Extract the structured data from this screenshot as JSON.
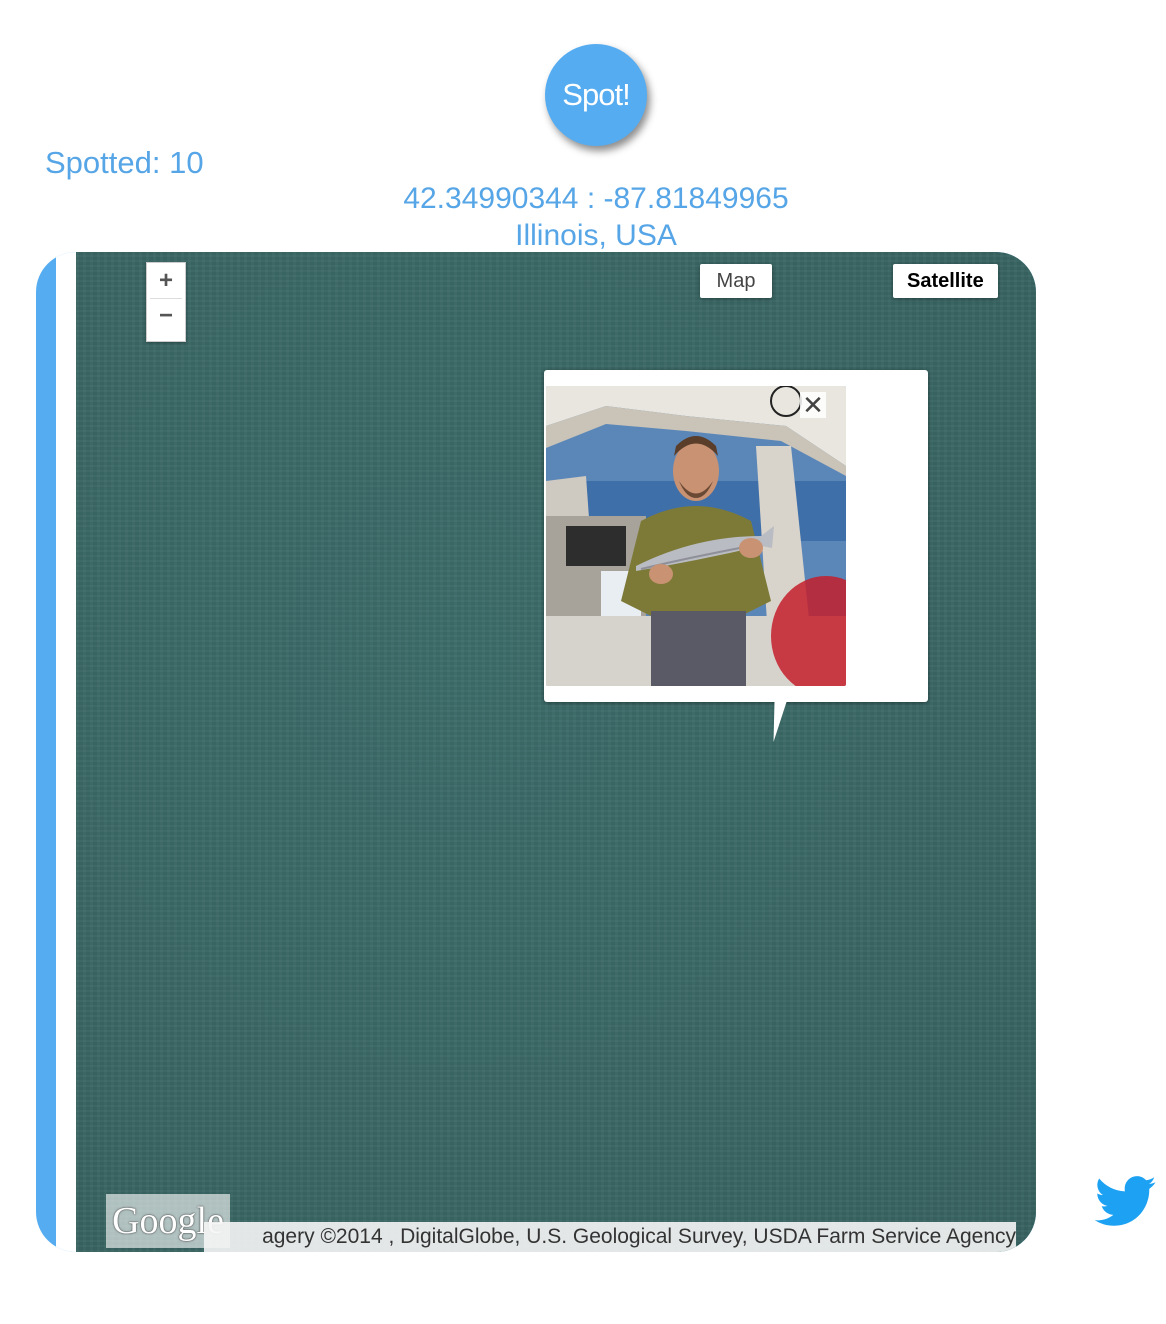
{
  "spot_button": {
    "label": "Spot!"
  },
  "spotted": {
    "text": "Spotted: 10"
  },
  "location": {
    "coordinates": "42.34990344 : -87.81849965",
    "place": "Illinois, USA"
  },
  "map": {
    "zoom_in_label": "+",
    "zoom_out_label": "−",
    "type_map_label": "Map",
    "type_satellite_label": "Satellite",
    "close_label": "✕",
    "google_logo_text": "Google",
    "attribution": "agery ©2014 , DigitalGlobe, U.S. Geological Survey, USDA Farm Service Agency",
    "water_color": "#3a6765"
  },
  "accent_color": "#56acf0",
  "icons": {
    "twitter": "twitter-bird-icon",
    "close": "close-icon"
  }
}
